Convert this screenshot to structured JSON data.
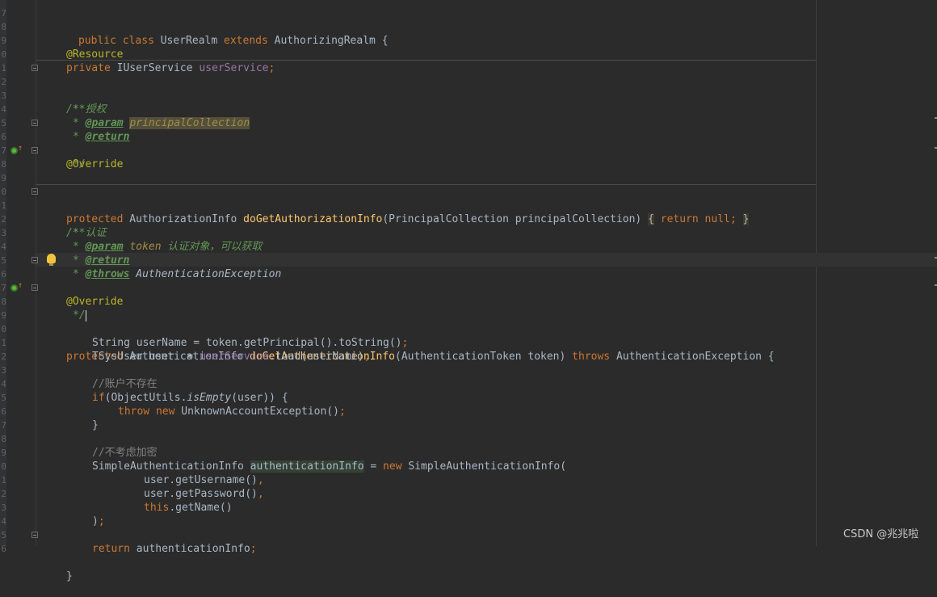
{
  "editor": {
    "line_numbers": [
      "7",
      "8",
      "9",
      "0",
      "1",
      "2",
      "3",
      "4",
      "5",
      "6",
      "7",
      "8",
      "9",
      "0",
      "1",
      "2",
      "3",
      "4",
      "5",
      "6",
      "7",
      "8",
      "9",
      "0",
      "1",
      "2",
      "3",
      "4",
      "5",
      "6",
      "7",
      "8",
      "9",
      "0",
      "1",
      "2",
      "3",
      "4",
      "5",
      "6",
      "7",
      "8",
      "9"
    ],
    "code": {
      "class_decl": [
        "public",
        "class",
        "UserRealm",
        "extends",
        "AuthorizingRealm",
        "{"
      ],
      "l_resource": "@Resource",
      "l_field": [
        "private",
        "IUserService",
        "userService",
        ";"
      ],
      "doc1": {
        "open": "/**",
        "desc": "* 授权",
        "param_tag": "@param",
        "param_name": "principalCollection",
        "return_tag": "@return",
        "close": "*/"
      },
      "override": "@Override",
      "authz": [
        "protected",
        "AuthorizationInfo",
        "doGetAuthorizationInfo",
        "(PrincipalCollection principalCollection)",
        "{",
        "return",
        "null;",
        "}"
      ],
      "doc2": {
        "open": "/**",
        "desc": "* 认证",
        "param_tag": "@param",
        "param_name": "token",
        "param_desc": "认证对象，可以获取",
        "return_tag": "@return",
        "throws_tag": "@throws",
        "throws_type": "AuthenticationException",
        "close": "*/"
      },
      "authn": [
        "protected",
        "AuthenticationInfo",
        "doGetAuthenticationInfo",
        "(AuthenticationToken token)",
        "throws",
        "AuthenticationException {"
      ],
      "l_username": [
        "String userName = token.getPrincipal().toString()",
        ";"
      ],
      "l_user": [
        "TSysUser user  = ",
        "userService",
        ".load(userName)",
        ";"
      ],
      "comment_no_account": "//账户不存在",
      "l_if": [
        "if",
        "(ObjectUtils.",
        "isEmpty",
        "(user)) {"
      ],
      "l_throw": [
        "throw",
        "new",
        "UnknownAccountException()",
        ";"
      ],
      "l_close_brace": "}",
      "comment_no_encrypt": "//不考虑加密",
      "l_sai": [
        "SimpleAuthenticationInfo ",
        "authenticationInfo",
        " = ",
        "new",
        " SimpleAuthenticationInfo("
      ],
      "l_getusername": [
        "user.getUsername()",
        ","
      ],
      "l_getpassword": [
        "user.getPassword()",
        ","
      ],
      "l_getname": [
        "this",
        ".getName()"
      ],
      "l_paren_close": [
        ")",
        ";"
      ],
      "l_return": [
        "return",
        " authenticationInfo",
        ";"
      ],
      "l_method_close": "}"
    }
  },
  "icons": {
    "fold_marker": "fold-icon",
    "override_gutter": "implements-method-icon",
    "intention": "lightbulb-icon"
  },
  "watermark": "CSDN @兆兆啦",
  "colors": {
    "background": "#2b2b2b",
    "keyword": "#cc7832",
    "annotation": "#bbb529",
    "doc_comment": "#629755",
    "line_comment": "#808080",
    "field": "#9876aa",
    "method_decl": "#ffc66d",
    "text": "#a9b7c6"
  }
}
